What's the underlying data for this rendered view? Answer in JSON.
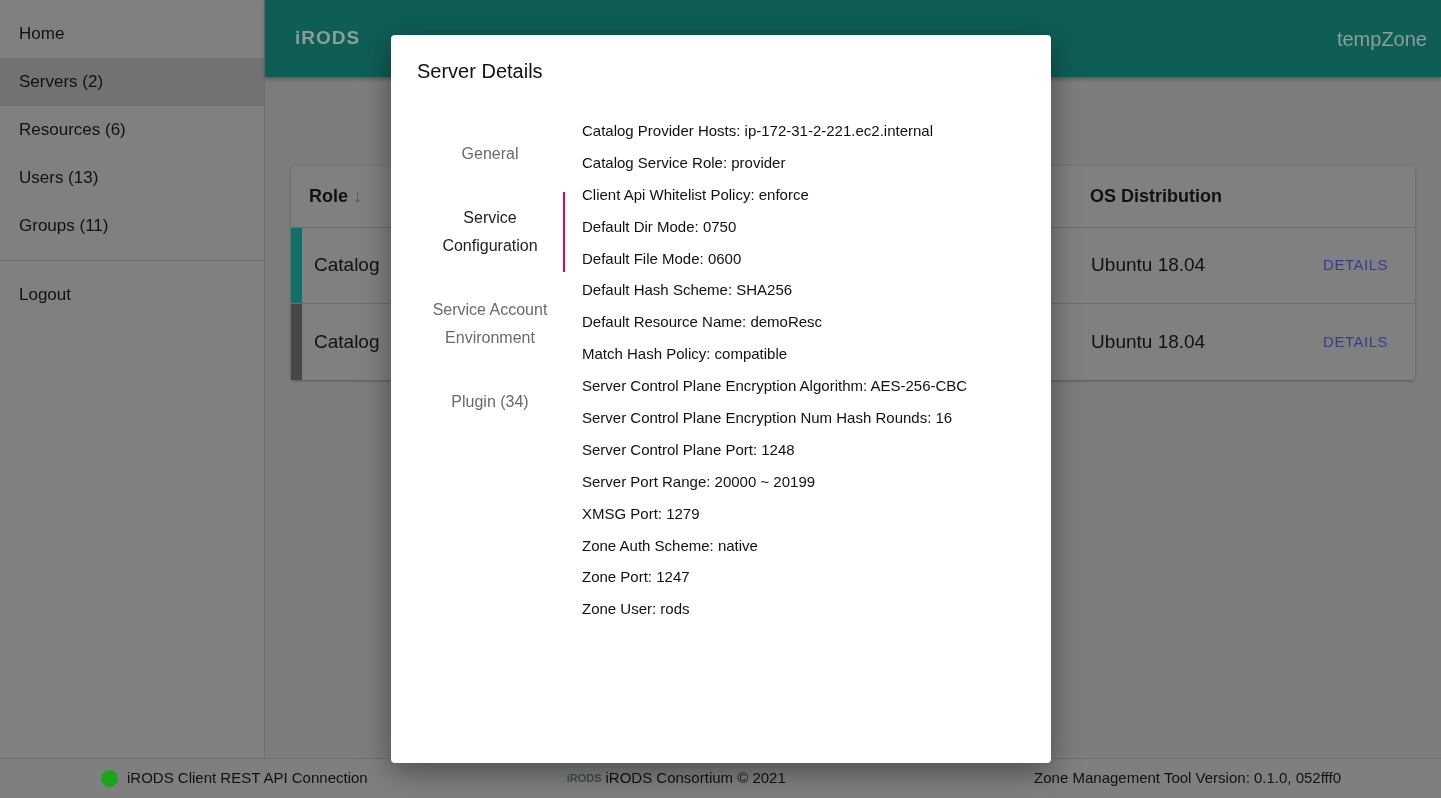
{
  "sidebar": {
    "items": [
      {
        "label": "Home",
        "selected": false
      },
      {
        "label": "Servers (2)",
        "selected": true
      },
      {
        "label": "Resources (6)",
        "selected": false
      },
      {
        "label": "Users (13)",
        "selected": false
      },
      {
        "label": "Groups (11)",
        "selected": false
      }
    ],
    "logout": "Logout"
  },
  "header": {
    "logo": "iRODS",
    "zone": "tempZone"
  },
  "table": {
    "columns": [
      {
        "label": "Role",
        "sort": "↓"
      },
      {
        "label": "OS Distribution"
      }
    ],
    "rows": [
      {
        "column_1": "Catalog",
        "os": "Ubuntu 18.04",
        "action": "DETAILS",
        "color": "#12706a"
      },
      {
        "column_1": "Catalog",
        "os": "Ubuntu 18.04",
        "action": "DETAILS",
        "color": "#474747"
      }
    ]
  },
  "modal": {
    "title": "Server Details",
    "tabs": [
      {
        "label": "General",
        "selected": false
      },
      {
        "label": "Service Configuration",
        "selected": true
      },
      {
        "label": "Service Account Environment",
        "selected": false
      },
      {
        "label": "Plugin (34)",
        "selected": false
      }
    ],
    "properties": [
      "Catalog Provider Hosts: ip-172-31-2-221.ec2.internal",
      "Catalog Service Role: provider",
      "Client Api Whitelist Policy: enforce",
      "Default Dir Mode: 0750",
      "Default File Mode: 0600",
      "Default Hash Scheme: SHA256",
      "Default Resource Name: demoResc",
      "Match Hash Policy: compatible",
      "Server Control Plane Encryption Algorithm: AES-256-CBC",
      "Server Control Plane Encryption Num Hash Rounds: 16",
      "Server Control Plane Port: 1248",
      "Server Port Range: 20000 ~ 20199",
      "XMSG Port: 1279",
      "Zone Auth Scheme: native",
      "Zone Port: 1247",
      "Zone User: rods"
    ]
  },
  "status_bar": {
    "connection": {
      "label": "iRODS Client REST API Connection",
      "color": "#1aa51a"
    },
    "logo": "iRODS",
    "copyright": "iRODS Consortium © 2021",
    "version": "Zone Management Tool Version: 0.1.0, 052fff0"
  }
}
